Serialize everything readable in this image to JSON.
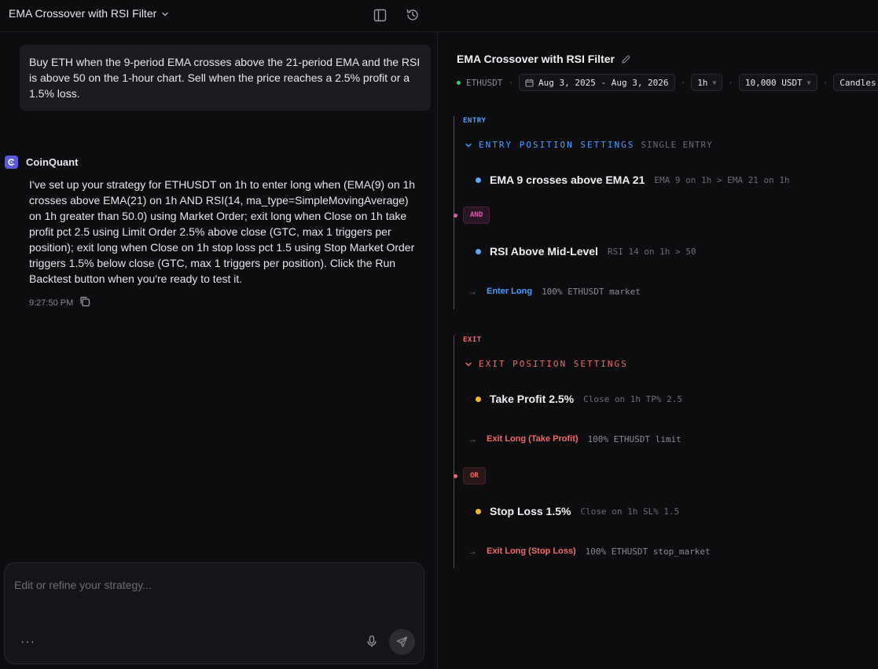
{
  "header": {
    "strategy_title": "EMA Crossover with RSI Filter"
  },
  "chat": {
    "user_message": "Buy ETH when the 9-period EMA crosses above the 21-period EMA and the RSI is above 50 on the 1-hour chart. Sell when the price reaches a 2.5% profit or a 1.5% loss.",
    "bot_name": "CoinQuant",
    "bot_message": "I've set up your strategy for ETHUSDT on 1h to enter long when (EMA(9) on 1h crosses above EMA(21) on 1h AND RSI(14, ma_type=SimpleMovingAverage) on 1h greater than 50.0) using Market Order; exit long when Close on 1h take profit pct 2.5 using Limit Order 2.5% above close (GTC, max 1 triggers per position); exit long when Close on 1h stop loss pct 1.5 using Stop Market Order triggers 1.5% below close (GTC, max 1 triggers per position). Click the Run Backtest button when you're ready to test it.",
    "timestamp": "9:27:50 PM",
    "composer_placeholder": "Edit or refine your strategy...",
    "more_label": "···"
  },
  "panel": {
    "title": "EMA Crossover with RSI Filter",
    "symbol": "ETHUSDT",
    "date_range": "Aug 3, 2025 - Aug 3, 2026",
    "timeframe": "1h",
    "capital": "10,000 USDT",
    "chart_mode": "Candles",
    "entry": {
      "section_label": "ENTRY",
      "settings_title": "ENTRY POSITION SETTINGS",
      "settings_sub": "SINGLE ENTRY",
      "conditions": [
        {
          "name": "EMA 9 crosses above EMA 21",
          "detail": "EMA 9 on 1h > EMA 21 on 1h"
        },
        {
          "name": "RSI Above Mid-Level",
          "detail": "RSI 14 on 1h > 50"
        }
      ],
      "connector": "AND",
      "action": {
        "label": "Enter Long",
        "detail": "100% ETHUSDT market"
      }
    },
    "exit": {
      "section_label": "EXIT",
      "settings_title": "EXIT POSITION SETTINGS",
      "conditions": [
        {
          "name": "Take Profit 2.5%",
          "detail": "Close on 1h TP% 2.5",
          "action_label": "Exit Long (Take Profit)",
          "action_detail": "100% ETHUSDT limit"
        },
        {
          "name": "Stop Loss 1.5%",
          "detail": "Close on 1h SL% 1.5",
          "action_label": "Exit Long (Stop Loss)",
          "action_detail": "100% ETHUSDT stop_market"
        }
      ],
      "connector": "OR"
    }
  },
  "colors": {
    "entry_accent": "#4a9eff",
    "exit_accent": "#f06a6a",
    "and_accent": "#e05bb5",
    "bullet_blue": "#5aa9ff",
    "bullet_yellow": "#f5b82e"
  }
}
